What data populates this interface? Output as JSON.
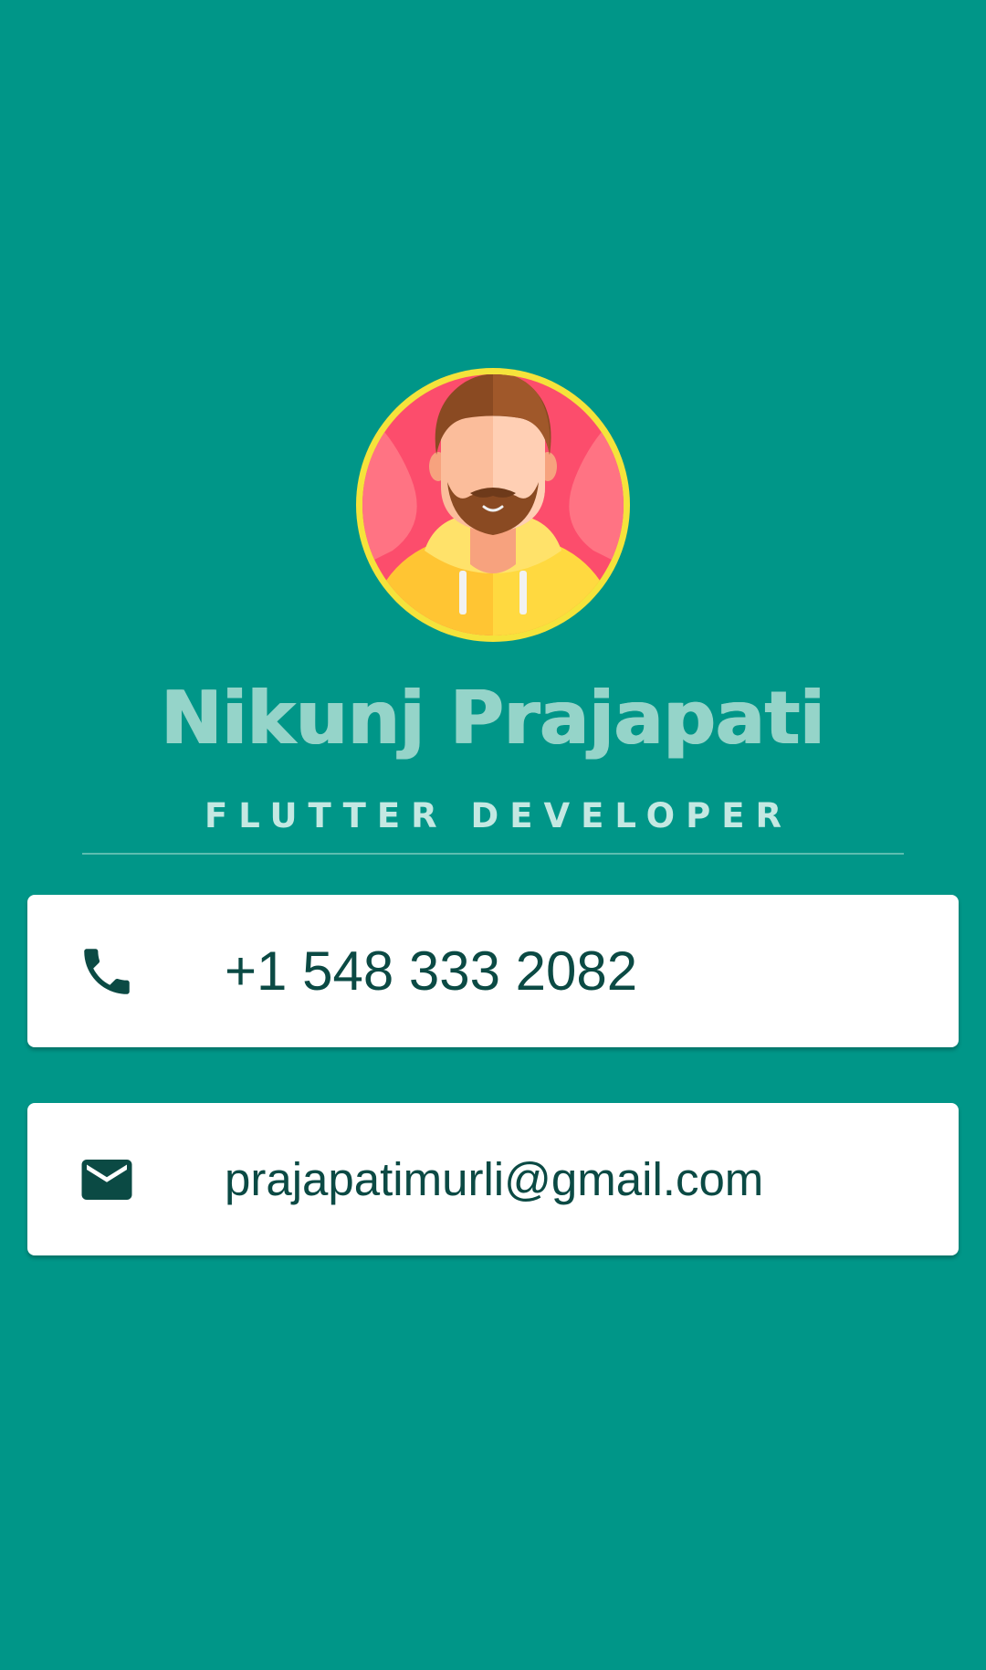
{
  "profile": {
    "avatar_icon": "bearded-man-avatar-icon",
    "name": "Nikunj Prajapati",
    "title": "FLUTTER DEVELOPER"
  },
  "contacts": [
    {
      "icon": "phone-icon",
      "value": "+1 548 333 2082"
    },
    {
      "icon": "mail-icon",
      "value": "prajapatimurli@gmail.com"
    }
  ],
  "colors": {
    "background": "#009688",
    "name": "#95d4c9",
    "title": "#c4e8e2",
    "card_text": "#0b4a44",
    "card_icon": "#0b4a44",
    "card_bg": "#ffffff",
    "avatar_ring": "#f5e33b",
    "avatar_bg": "#fc4d6c"
  }
}
